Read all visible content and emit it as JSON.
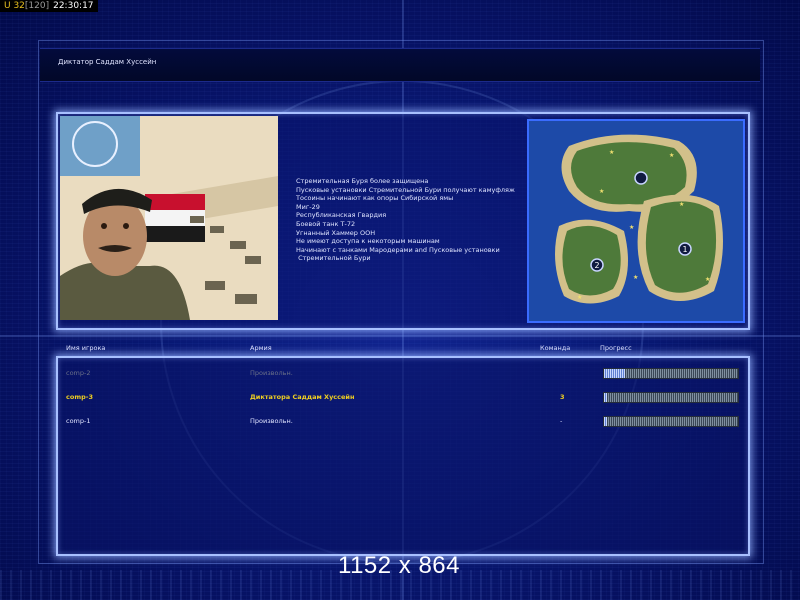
{
  "status_bar": {
    "units": "U 32",
    "cap": "[120]",
    "clock": "22:30:17"
  },
  "header": {
    "title": "Диктатор Саддам Хуссейн"
  },
  "briefing_lines": [
    "Стремительная Буря более защищена",
    "Пусковые установки Стремительной Бури получают камуфляж",
    "Тоcоины начинают как опоры Сибирской ямы",
    "Миг-29",
    "Республиканская Гвардия",
    "Боевой танк Т-72",
    "Угнанный Хаммер ООН",
    "Не имеют доступа к некоторым машинам",
    "Начинают с танками Мародерами and Пусковые установки",
    " Стремительной Бури"
  ],
  "table": {
    "columns": [
      "Имя игрока",
      "Армия",
      "Команда",
      "Прогресс"
    ],
    "rows": [
      {
        "name": "comp-2",
        "army": "Произвольн.",
        "team": "",
        "progress": 0.16,
        "state": "dim"
      },
      {
        "name": "comp-3",
        "army": "Диктатора Саддам Хуссейн",
        "team": "3",
        "progress": 0.02,
        "state": "selected"
      },
      {
        "name": "comp-1",
        "army": "Произвольн.",
        "team": "-",
        "progress": 0.02,
        "state": "normal"
      }
    ]
  },
  "map": {
    "markers": [
      "1",
      "2"
    ]
  },
  "overlay": {
    "resolution": "1152 x 864"
  },
  "colors": {
    "accent": "#a8c0ff",
    "selected": "#f0d020",
    "background": "#0a1a78"
  }
}
